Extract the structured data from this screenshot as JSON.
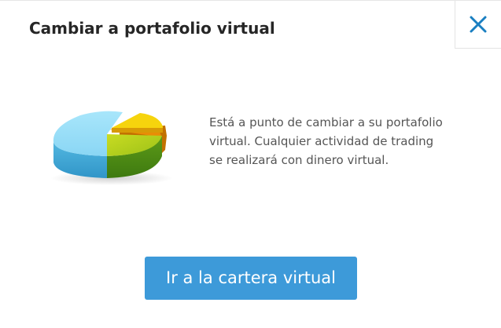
{
  "dialog": {
    "title": "Cambiar a portafolio virtual",
    "message": "Está a punto de cambiar a su portafolio virtual. Cualquier actividad de trading se realizará con dinero virtual.",
    "primary_button_label": "Ir a la cartera virtual",
    "close_icon": "close-icon",
    "illustration_icon": "pie-chart-icon"
  },
  "colors": {
    "accent": "#3d9ad9",
    "close_icon": "#1a7fc1",
    "title": "#262626",
    "body_text": "#555555"
  }
}
